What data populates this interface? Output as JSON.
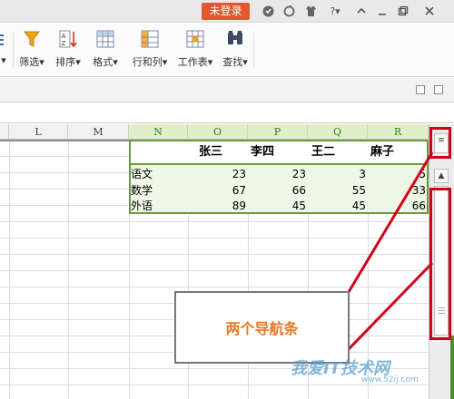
{
  "titlebar": {
    "login_label": "未登录",
    "icons": [
      "skin-icon",
      "feedback-icon",
      "shirt-icon",
      "help-icon",
      "minimize-icon",
      "restore-icon",
      "close-icon"
    ]
  },
  "ribbon": {
    "items": [
      {
        "label": "筛选",
        "icon": "filter-icon"
      },
      {
        "label": "排序",
        "icon": "sort-icon"
      },
      {
        "label": "格式",
        "icon": "format-icon"
      },
      {
        "label": "行和列",
        "icon": "rows-cols-icon"
      },
      {
        "label": "工作表",
        "icon": "worksheet-icon"
      },
      {
        "label": "查找",
        "icon": "find-icon"
      }
    ]
  },
  "sheet": {
    "columns": [
      "L",
      "M",
      "N",
      "O",
      "P",
      "Q",
      "R"
    ],
    "header_names": [
      "张三",
      "李四",
      "王二",
      "麻子"
    ],
    "rows": [
      {
        "subject": "语文",
        "values": [
          "23",
          "23",
          "3",
          "5"
        ]
      },
      {
        "subject": "数学",
        "values": [
          "67",
          "66",
          "55",
          "33"
        ]
      },
      {
        "subject": "外语",
        "values": [
          "89",
          "45",
          "45",
          "66"
        ]
      }
    ]
  },
  "annotation": {
    "text": "两个导航条",
    "color": "#e87722",
    "highlight_color": "#d0021b"
  },
  "watermark": {
    "text": "我爱IT技术网",
    "sub": "www.52ij.com"
  }
}
